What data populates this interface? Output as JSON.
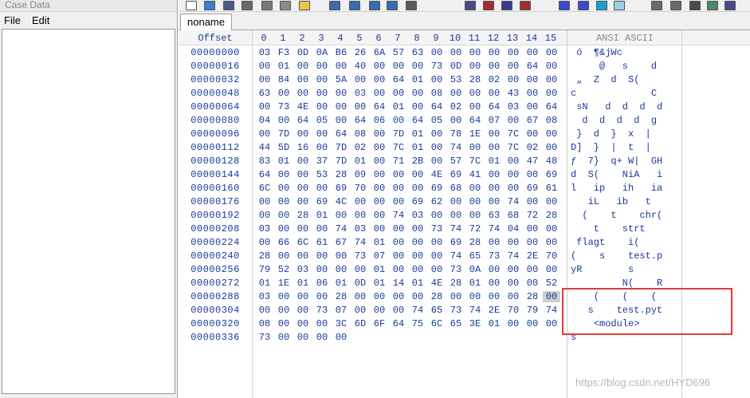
{
  "left_panel": {
    "title": "Case Data",
    "menu": [
      "File",
      "Edit"
    ]
  },
  "toolbar": {
    "icons": [
      {
        "name": "new-file-icon",
        "color": "#ffffff"
      },
      {
        "name": "open-icon",
        "color": "#3a7fd0"
      },
      {
        "name": "save-icon",
        "color": "#4a5a8a"
      },
      {
        "name": "print-icon",
        "color": "#6a6a6a"
      },
      {
        "name": "properties-icon",
        "color": "#7a7a7a"
      },
      {
        "name": "clipboard-icon",
        "color": "#8a8a8a"
      },
      {
        "name": "note-icon",
        "color": "#e8c84a"
      },
      {
        "name": "copy-icon",
        "color": "#3a6ab0"
      },
      {
        "name": "paste-icon",
        "color": "#3a6ab0"
      },
      {
        "name": "paste-block-icon",
        "color": "#3a6ab0"
      },
      {
        "name": "edit-block-icon",
        "color": "#3a6ab0"
      },
      {
        "name": "binary-icon",
        "color": "#5a5a5a"
      },
      {
        "name": "find-icon",
        "color": "#4a4a8a"
      },
      {
        "name": "find-hex-icon",
        "color": "#a03030"
      },
      {
        "name": "replace-icon",
        "color": "#3a3a8a"
      },
      {
        "name": "replace-hex-icon",
        "color": "#a03030"
      },
      {
        "name": "goto-icon",
        "color": "#3a4ad0"
      },
      {
        "name": "goto-offset-icon",
        "color": "#3a4ad0"
      },
      {
        "name": "back-icon",
        "color": "#1aa0d8"
      },
      {
        "name": "forward-icon",
        "color": "#9ad0e8"
      },
      {
        "name": "disk-icon",
        "color": "#6a6a6a"
      },
      {
        "name": "disk-open-icon",
        "color": "#6a6a6a"
      },
      {
        "name": "ram-icon",
        "color": "#4a4a4a"
      },
      {
        "name": "calculator-icon",
        "color": "#4a8a6a"
      },
      {
        "name": "search-icon",
        "color": "#4a4a8a"
      }
    ]
  },
  "tab": {
    "label": "noname"
  },
  "hex": {
    "offset_header": "Offset",
    "columns": [
      "0",
      "1",
      "2",
      "3",
      "4",
      "5",
      "6",
      "7",
      "8",
      "9",
      "10",
      "11",
      "12",
      "13",
      "14",
      "15"
    ],
    "ascii_header": "ANSI ASCII",
    "selected_cell": {
      "row": 18,
      "col": 15
    },
    "rows": [
      {
        "offset": "00000000",
        "bytes": [
          "03",
          "F3",
          "0D",
          "0A",
          "B6",
          "26",
          "6A",
          "57",
          "63",
          "00",
          "00",
          "00",
          "00",
          "00",
          "00",
          "00"
        ],
        "ascii": " ó  ¶&jWc"
      },
      {
        "offset": "00000016",
        "bytes": [
          "00",
          "01",
          "00",
          "00",
          "00",
          "40",
          "00",
          "00",
          "00",
          "73",
          "0D",
          "00",
          "00",
          "00",
          "64",
          "00"
        ],
        "ascii": "     @   s    d"
      },
      {
        "offset": "00000032",
        "bytes": [
          "00",
          "84",
          "00",
          "00",
          "5A",
          "00",
          "00",
          "64",
          "01",
          "00",
          "53",
          "28",
          "02",
          "00",
          "00",
          "00"
        ],
        "ascii": " „  Z  d  S("
      },
      {
        "offset": "00000048",
        "bytes": [
          "63",
          "00",
          "00",
          "00",
          "00",
          "03",
          "00",
          "00",
          "00",
          "08",
          "00",
          "00",
          "00",
          "43",
          "00",
          "00"
        ],
        "ascii": "c             C"
      },
      {
        "offset": "00000064",
        "bytes": [
          "00",
          "73",
          "4E",
          "00",
          "00",
          "00",
          "64",
          "01",
          "00",
          "64",
          "02",
          "00",
          "64",
          "03",
          "00",
          "64"
        ],
        "ascii": " sN   d  d  d  d"
      },
      {
        "offset": "00000080",
        "bytes": [
          "04",
          "00",
          "64",
          "05",
          "00",
          "64",
          "06",
          "00",
          "64",
          "05",
          "00",
          "64",
          "07",
          "00",
          "67",
          "08"
        ],
        "ascii": "  d  d  d  d  g"
      },
      {
        "offset": "00000096",
        "bytes": [
          "00",
          "7D",
          "00",
          "00",
          "64",
          "08",
          "00",
          "7D",
          "01",
          "00",
          "78",
          "1E",
          "00",
          "7C",
          "00",
          "00"
        ],
        "ascii": " }  d  }  x  |"
      },
      {
        "offset": "00000112",
        "bytes": [
          "44",
          "5D",
          "16",
          "00",
          "7D",
          "02",
          "00",
          "7C",
          "01",
          "00",
          "74",
          "00",
          "00",
          "7C",
          "02",
          "00"
        ],
        "ascii": "D]  }  |  t  |"
      },
      {
        "offset": "00000128",
        "bytes": [
          "83",
          "01",
          "00",
          "37",
          "7D",
          "01",
          "00",
          "71",
          "2B",
          "00",
          "57",
          "7C",
          "01",
          "00",
          "47",
          "48"
        ],
        "ascii": "ƒ  7}  q+ W|  GH"
      },
      {
        "offset": "00000144",
        "bytes": [
          "64",
          "00",
          "00",
          "53",
          "28",
          "09",
          "00",
          "00",
          "00",
          "4E",
          "69",
          "41",
          "00",
          "00",
          "00",
          "69"
        ],
        "ascii": "d  S(    NiA   i"
      },
      {
        "offset": "00000160",
        "bytes": [
          "6C",
          "00",
          "00",
          "00",
          "69",
          "70",
          "00",
          "00",
          "00",
          "69",
          "68",
          "00",
          "00",
          "00",
          "69",
          "61"
        ],
        "ascii": "l   ip   ih   ia"
      },
      {
        "offset": "00000176",
        "bytes": [
          "00",
          "00",
          "00",
          "69",
          "4C",
          "00",
          "00",
          "00",
          "69",
          "62",
          "00",
          "00",
          "00",
          "74",
          "00",
          "00"
        ],
        "ascii": "   iL   ib   t"
      },
      {
        "offset": "00000192",
        "bytes": [
          "00",
          "00",
          "28",
          "01",
          "00",
          "00",
          "00",
          "74",
          "03",
          "00",
          "00",
          "00",
          "63",
          "68",
          "72",
          "28"
        ],
        "ascii": "  (    t    chr("
      },
      {
        "offset": "00000208",
        "bytes": [
          "03",
          "00",
          "00",
          "00",
          "74",
          "03",
          "00",
          "00",
          "00",
          "73",
          "74",
          "72",
          "74",
          "04",
          "00",
          "00"
        ],
        "ascii": "    t    strt"
      },
      {
        "offset": "00000224",
        "bytes": [
          "00",
          "66",
          "6C",
          "61",
          "67",
          "74",
          "01",
          "00",
          "00",
          "00",
          "69",
          "28",
          "00",
          "00",
          "00",
          "00"
        ],
        "ascii": " flagt    i("
      },
      {
        "offset": "00000240",
        "bytes": [
          "28",
          "00",
          "00",
          "00",
          "00",
          "73",
          "07",
          "00",
          "00",
          "00",
          "74",
          "65",
          "73",
          "74",
          "2E",
          "70"
        ],
        "ascii": "(    s    test.p"
      },
      {
        "offset": "00000256",
        "bytes": [
          "79",
          "52",
          "03",
          "00",
          "00",
          "00",
          "01",
          "00",
          "00",
          "00",
          "73",
          "0A",
          "00",
          "00",
          "00",
          "00"
        ],
        "ascii": "yR        s"
      },
      {
        "offset": "00000272",
        "bytes": [
          "01",
          "1E",
          "01",
          "06",
          "01",
          "0D",
          "01",
          "14",
          "01",
          "4E",
          "28",
          "01",
          "00",
          "00",
          "00",
          "52"
        ],
        "ascii": "         N(    R"
      },
      {
        "offset": "00000288",
        "bytes": [
          "03",
          "00",
          "00",
          "00",
          "28",
          "00",
          "00",
          "00",
          "00",
          "28",
          "00",
          "00",
          "00",
          "00",
          "28",
          "00"
        ],
        "ascii": "    (    (    ("
      },
      {
        "offset": "00000304",
        "bytes": [
          "00",
          "00",
          "00",
          "73",
          "07",
          "00",
          "00",
          "00",
          "74",
          "65",
          "73",
          "74",
          "2E",
          "70",
          "79",
          "74"
        ],
        "ascii": "   s    test.pyt"
      },
      {
        "offset": "00000320",
        "bytes": [
          "08",
          "00",
          "00",
          "00",
          "3C",
          "6D",
          "6F",
          "64",
          "75",
          "6C",
          "65",
          "3E",
          "01",
          "00",
          "00",
          "00"
        ],
        "ascii": "    <module>"
      },
      {
        "offset": "00000336",
        "bytes": [
          "73",
          "00",
          "00",
          "00",
          "00"
        ],
        "ascii": "s"
      }
    ]
  },
  "watermark": "https://blog.csdn.net/HYD696"
}
